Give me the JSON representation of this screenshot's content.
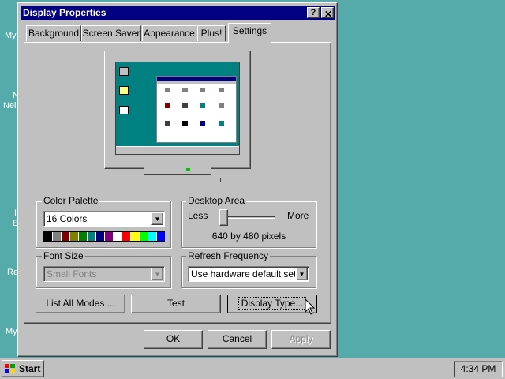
{
  "desktop": {
    "icons": [
      {
        "label": "My"
      },
      {
        "label": "N"
      },
      {
        "label": "Neig"
      },
      {
        "label": "I"
      },
      {
        "label": "E"
      },
      {
        "label": "Re"
      },
      {
        "label": "My"
      }
    ]
  },
  "window": {
    "title": "Display Properties",
    "help_label": "?",
    "close_label": "✕",
    "tabs": [
      {
        "label": "Background"
      },
      {
        "label": "Screen Saver"
      },
      {
        "label": "Appearance"
      },
      {
        "label": "Plus!"
      },
      {
        "label": "Settings",
        "active": true
      }
    ],
    "color_palette": {
      "label": "Color Palette",
      "value": "16 Colors",
      "swatches": [
        "#000000",
        "#808080",
        "#800000",
        "#808000",
        "#008000",
        "#008080",
        "#000080",
        "#800080",
        "#ffffff",
        "#ff0000",
        "#ffff00",
        "#00ff00",
        "#00ffff",
        "#0000ff"
      ]
    },
    "desktop_area": {
      "label": "Desktop Area",
      "less": "Less",
      "more": "More",
      "resolution": "640 by 480 pixels",
      "slider_level": 0
    },
    "font_size": {
      "label": "Font Size",
      "value": "Small Fonts",
      "disabled": true
    },
    "refresh_frequency": {
      "label": "Refresh Frequency",
      "value": "Use hardware default setting"
    },
    "buttons": {
      "list_all_modes": "List All Modes ...",
      "test": "Test",
      "display_type": "Display Type...",
      "ok": "OK",
      "cancel": "Cancel",
      "apply": "Apply"
    }
  },
  "taskbar": {
    "start_label": "Start",
    "clock": "4:34 PM"
  },
  "colors": {
    "desktop": "#55aaaa",
    "face": "#c0c0c0",
    "titlebar": "#000080"
  }
}
